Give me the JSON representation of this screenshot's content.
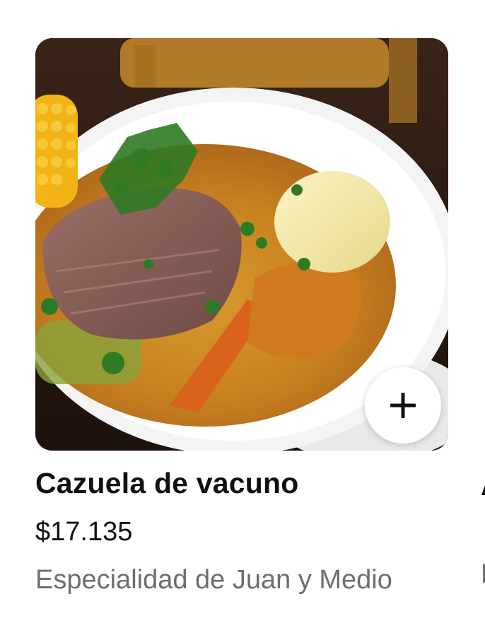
{
  "product": {
    "name": "Cazuela de vacuno",
    "price": "$17.135",
    "description": "Especialidad de Juan y Medio",
    "image_icon": "food-photo",
    "add_icon": "plus-icon"
  },
  "next_card_peek": {
    "title_char": "A",
    "desc_char": "E"
  }
}
